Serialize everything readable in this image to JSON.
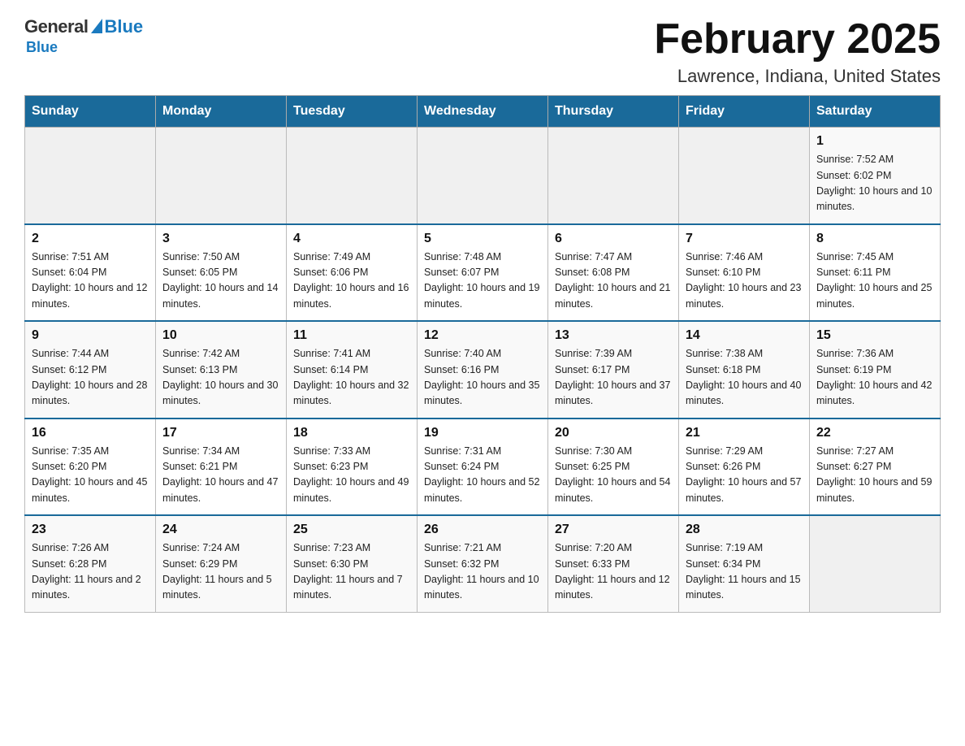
{
  "logo": {
    "general": "General",
    "blue": "Blue"
  },
  "header": {
    "title": "February 2025",
    "subtitle": "Lawrence, Indiana, United States"
  },
  "days_of_week": [
    "Sunday",
    "Monday",
    "Tuesday",
    "Wednesday",
    "Thursday",
    "Friday",
    "Saturday"
  ],
  "weeks": [
    [
      {
        "day": "",
        "sunrise": "",
        "sunset": "",
        "daylight": ""
      },
      {
        "day": "",
        "sunrise": "",
        "sunset": "",
        "daylight": ""
      },
      {
        "day": "",
        "sunrise": "",
        "sunset": "",
        "daylight": ""
      },
      {
        "day": "",
        "sunrise": "",
        "sunset": "",
        "daylight": ""
      },
      {
        "day": "",
        "sunrise": "",
        "sunset": "",
        "daylight": ""
      },
      {
        "day": "",
        "sunrise": "",
        "sunset": "",
        "daylight": ""
      },
      {
        "day": "1",
        "sunrise": "Sunrise: 7:52 AM",
        "sunset": "Sunset: 6:02 PM",
        "daylight": "Daylight: 10 hours and 10 minutes."
      }
    ],
    [
      {
        "day": "2",
        "sunrise": "Sunrise: 7:51 AM",
        "sunset": "Sunset: 6:04 PM",
        "daylight": "Daylight: 10 hours and 12 minutes."
      },
      {
        "day": "3",
        "sunrise": "Sunrise: 7:50 AM",
        "sunset": "Sunset: 6:05 PM",
        "daylight": "Daylight: 10 hours and 14 minutes."
      },
      {
        "day": "4",
        "sunrise": "Sunrise: 7:49 AM",
        "sunset": "Sunset: 6:06 PM",
        "daylight": "Daylight: 10 hours and 16 minutes."
      },
      {
        "day": "5",
        "sunrise": "Sunrise: 7:48 AM",
        "sunset": "Sunset: 6:07 PM",
        "daylight": "Daylight: 10 hours and 19 minutes."
      },
      {
        "day": "6",
        "sunrise": "Sunrise: 7:47 AM",
        "sunset": "Sunset: 6:08 PM",
        "daylight": "Daylight: 10 hours and 21 minutes."
      },
      {
        "day": "7",
        "sunrise": "Sunrise: 7:46 AM",
        "sunset": "Sunset: 6:10 PM",
        "daylight": "Daylight: 10 hours and 23 minutes."
      },
      {
        "day": "8",
        "sunrise": "Sunrise: 7:45 AM",
        "sunset": "Sunset: 6:11 PM",
        "daylight": "Daylight: 10 hours and 25 minutes."
      }
    ],
    [
      {
        "day": "9",
        "sunrise": "Sunrise: 7:44 AM",
        "sunset": "Sunset: 6:12 PM",
        "daylight": "Daylight: 10 hours and 28 minutes."
      },
      {
        "day": "10",
        "sunrise": "Sunrise: 7:42 AM",
        "sunset": "Sunset: 6:13 PM",
        "daylight": "Daylight: 10 hours and 30 minutes."
      },
      {
        "day": "11",
        "sunrise": "Sunrise: 7:41 AM",
        "sunset": "Sunset: 6:14 PM",
        "daylight": "Daylight: 10 hours and 32 minutes."
      },
      {
        "day": "12",
        "sunrise": "Sunrise: 7:40 AM",
        "sunset": "Sunset: 6:16 PM",
        "daylight": "Daylight: 10 hours and 35 minutes."
      },
      {
        "day": "13",
        "sunrise": "Sunrise: 7:39 AM",
        "sunset": "Sunset: 6:17 PM",
        "daylight": "Daylight: 10 hours and 37 minutes."
      },
      {
        "day": "14",
        "sunrise": "Sunrise: 7:38 AM",
        "sunset": "Sunset: 6:18 PM",
        "daylight": "Daylight: 10 hours and 40 minutes."
      },
      {
        "day": "15",
        "sunrise": "Sunrise: 7:36 AM",
        "sunset": "Sunset: 6:19 PM",
        "daylight": "Daylight: 10 hours and 42 minutes."
      }
    ],
    [
      {
        "day": "16",
        "sunrise": "Sunrise: 7:35 AM",
        "sunset": "Sunset: 6:20 PM",
        "daylight": "Daylight: 10 hours and 45 minutes."
      },
      {
        "day": "17",
        "sunrise": "Sunrise: 7:34 AM",
        "sunset": "Sunset: 6:21 PM",
        "daylight": "Daylight: 10 hours and 47 minutes."
      },
      {
        "day": "18",
        "sunrise": "Sunrise: 7:33 AM",
        "sunset": "Sunset: 6:23 PM",
        "daylight": "Daylight: 10 hours and 49 minutes."
      },
      {
        "day": "19",
        "sunrise": "Sunrise: 7:31 AM",
        "sunset": "Sunset: 6:24 PM",
        "daylight": "Daylight: 10 hours and 52 minutes."
      },
      {
        "day": "20",
        "sunrise": "Sunrise: 7:30 AM",
        "sunset": "Sunset: 6:25 PM",
        "daylight": "Daylight: 10 hours and 54 minutes."
      },
      {
        "day": "21",
        "sunrise": "Sunrise: 7:29 AM",
        "sunset": "Sunset: 6:26 PM",
        "daylight": "Daylight: 10 hours and 57 minutes."
      },
      {
        "day": "22",
        "sunrise": "Sunrise: 7:27 AM",
        "sunset": "Sunset: 6:27 PM",
        "daylight": "Daylight: 10 hours and 59 minutes."
      }
    ],
    [
      {
        "day": "23",
        "sunrise": "Sunrise: 7:26 AM",
        "sunset": "Sunset: 6:28 PM",
        "daylight": "Daylight: 11 hours and 2 minutes."
      },
      {
        "day": "24",
        "sunrise": "Sunrise: 7:24 AM",
        "sunset": "Sunset: 6:29 PM",
        "daylight": "Daylight: 11 hours and 5 minutes."
      },
      {
        "day": "25",
        "sunrise": "Sunrise: 7:23 AM",
        "sunset": "Sunset: 6:30 PM",
        "daylight": "Daylight: 11 hours and 7 minutes."
      },
      {
        "day": "26",
        "sunrise": "Sunrise: 7:21 AM",
        "sunset": "Sunset: 6:32 PM",
        "daylight": "Daylight: 11 hours and 10 minutes."
      },
      {
        "day": "27",
        "sunrise": "Sunrise: 7:20 AM",
        "sunset": "Sunset: 6:33 PM",
        "daylight": "Daylight: 11 hours and 12 minutes."
      },
      {
        "day": "28",
        "sunrise": "Sunrise: 7:19 AM",
        "sunset": "Sunset: 6:34 PM",
        "daylight": "Daylight: 11 hours and 15 minutes."
      },
      {
        "day": "",
        "sunrise": "",
        "sunset": "",
        "daylight": ""
      }
    ]
  ]
}
